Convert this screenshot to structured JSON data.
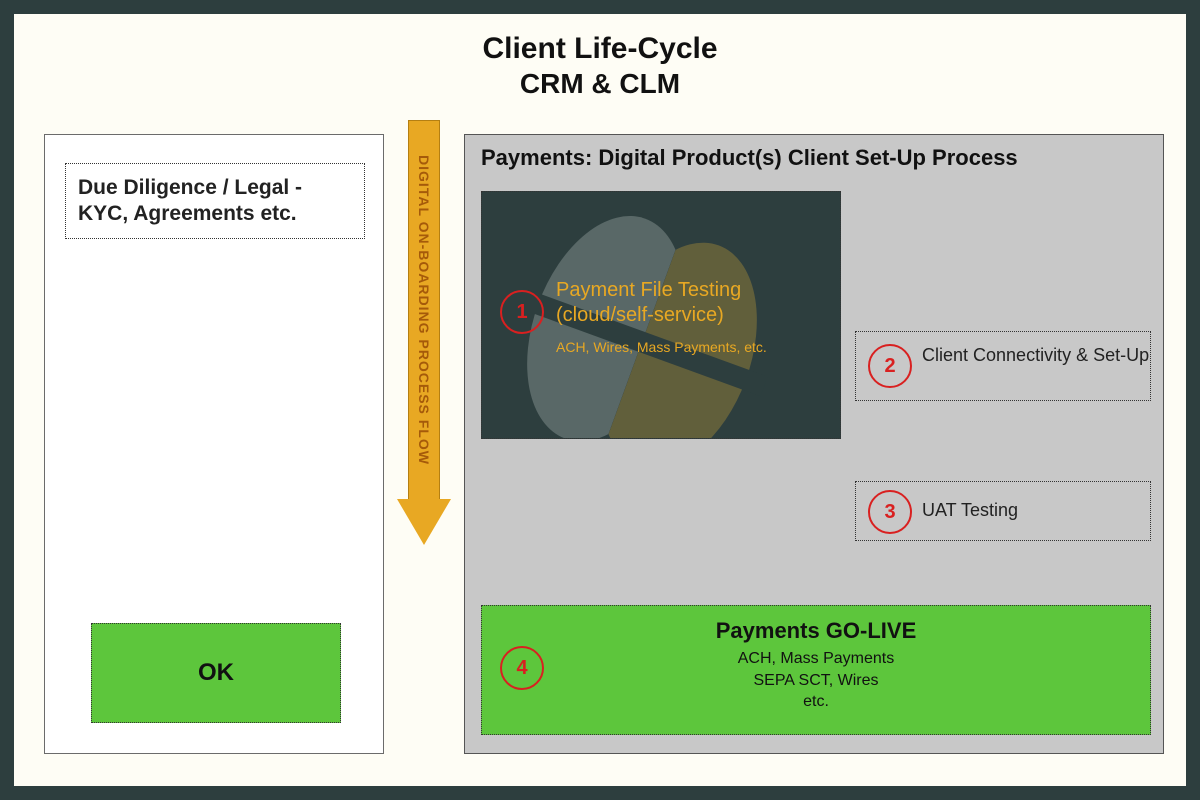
{
  "title": {
    "line1": "Client Life-Cycle",
    "line2": "CRM & CLM"
  },
  "left": {
    "due_diligence": "Due Diligence / Legal - KYC, Agreements etc.",
    "ok": "OK"
  },
  "flow_arrow_label": "DIGITAL ON-BOARDING PROCESS FLOW",
  "right": {
    "panel_title": "Payments: Digital Product(s) Client Set-Up Process",
    "step1": {
      "num": "1",
      "title": "Payment File Testing (cloud/self-service)",
      "sub": "ACH, Wires, Mass Payments, etc."
    },
    "step2": {
      "num": "2",
      "text": "Client Connectivity & Set-Up"
    },
    "step3": {
      "num": "3",
      "text": "UAT Testing"
    },
    "step4": {
      "num": "4",
      "title": "Payments GO-LIVE",
      "line_a": "ACH, Mass Payments",
      "line_b": "SEPA SCT, Wires",
      "line_c": "etc."
    }
  }
}
